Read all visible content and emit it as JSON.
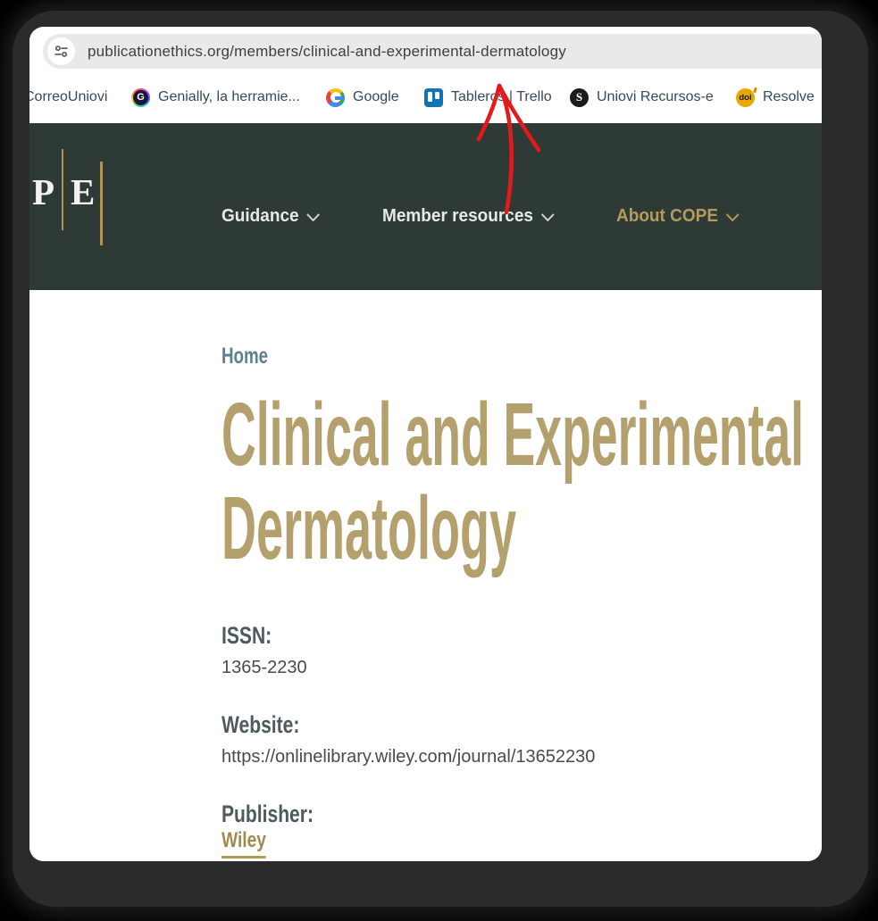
{
  "browser": {
    "url": "publicationethics.org/members/clinical-and-experimental-dermatology",
    "bookmarks": [
      {
        "label": "CorreoUniovi"
      },
      {
        "label": "Genially, la herramie...",
        "icon": "genially-icon",
        "letter": "G"
      },
      {
        "label": "Google",
        "icon": "google-icon"
      },
      {
        "label": "Tableros | Trello",
        "icon": "trello-icon"
      },
      {
        "label": "Uniovi Recursos-e",
        "icon": "uniovi-icon",
        "letter": "S"
      },
      {
        "label": "Resolve",
        "icon": "doi-icon",
        "letter": "doi"
      }
    ]
  },
  "site": {
    "logo": {
      "letter_p": "P",
      "letter_e": "E"
    },
    "nav": [
      {
        "label": "Guidance"
      },
      {
        "label": "Member resources"
      },
      {
        "label": "About COPE"
      }
    ],
    "breadcrumb": "Home",
    "title_line1": "Clinical and Experimental",
    "title_line2": "Dermatology",
    "fields": {
      "issn": {
        "heading": "ISSN:",
        "value": "1365-2230"
      },
      "website": {
        "heading": "Website:",
        "value": "https://onlinelibrary.wiley.com/journal/13652230"
      },
      "publisher": {
        "heading": "Publisher:",
        "value": "Wiley"
      }
    }
  },
  "colors": {
    "header_background": "#2e3a35",
    "accent_gold": "#b49b5d",
    "title_gold": "#b3a06d",
    "annotation_red": "#e3191c"
  }
}
